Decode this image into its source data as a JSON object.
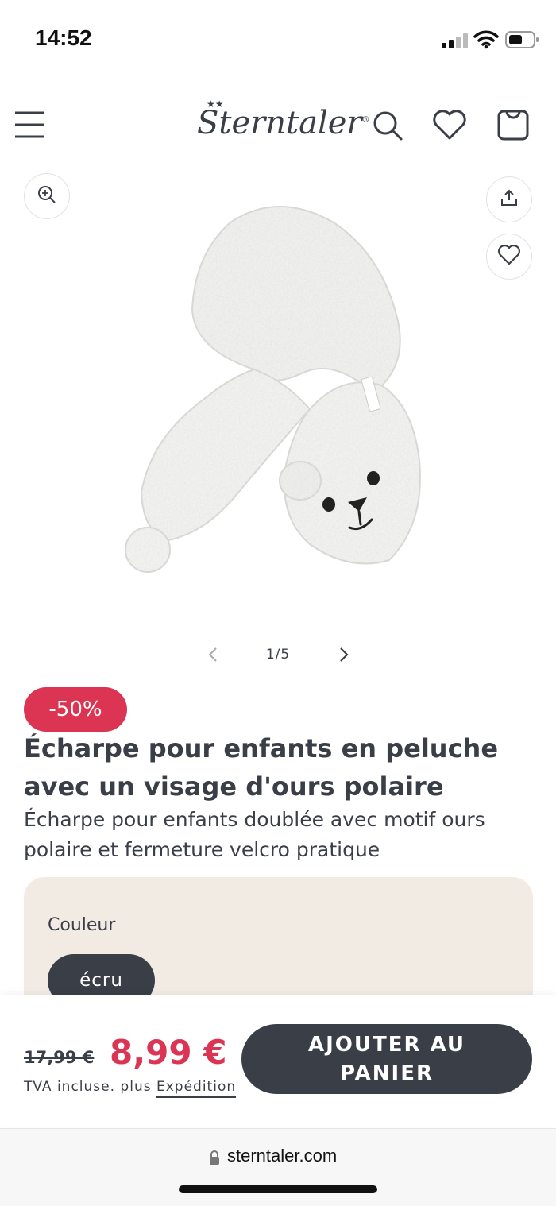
{
  "status_bar": {
    "time": "14:52"
  },
  "header": {
    "logo": "Sterntaler",
    "logo_mark": "®",
    "icons": [
      "menu-icon",
      "search-icon",
      "heart-icon",
      "bag-icon"
    ]
  },
  "gallery": {
    "pager": "1/5",
    "buttons": [
      "zoom-icon",
      "share-icon",
      "heart-icon"
    ]
  },
  "product": {
    "discount": "-50%",
    "title": "Écharpe pour enfants en peluche avec un visage d'ours polaire",
    "subtitle": "Écharpe pour enfants doublée avec motif ours polaire et fermeture velcro pratique",
    "color_label": "Couleur",
    "color_value": "écru"
  },
  "cart": {
    "old_price": "17,99 €",
    "new_price": "8,99 €",
    "vat_prefix": "TVA incluse. plus ",
    "shipping_link": "Expédition",
    "add_to_cart": "AJOUTER AU PANIER"
  },
  "browser": {
    "url": "sterntaler.com"
  },
  "colors": {
    "accent_red": "#dc3553",
    "dark": "#3a3f47",
    "panel_bg": "#f1ebe4"
  }
}
